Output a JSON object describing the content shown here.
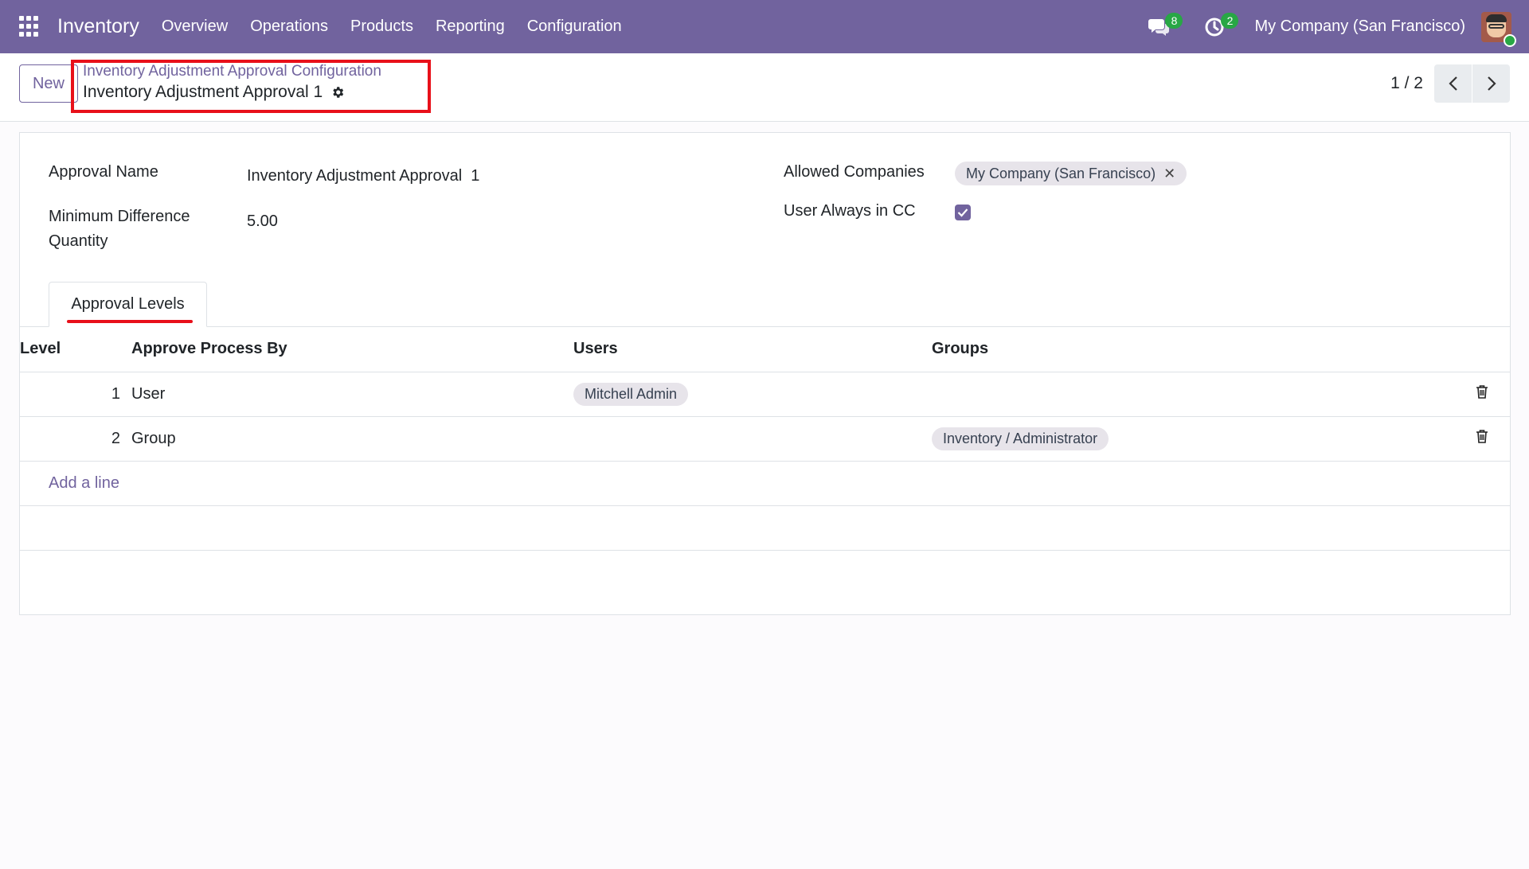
{
  "navbar": {
    "brand": "Inventory",
    "menu": [
      "Overview",
      "Operations",
      "Products",
      "Reporting",
      "Configuration"
    ],
    "messages_count": "8",
    "activities_count": "2",
    "company": "My Company (San Francisco)"
  },
  "control_panel": {
    "new_label": "New",
    "breadcrumb_parent": "Inventory Adjustment Approval Configuration",
    "breadcrumb_current": "Inventory Adjustment Approval 1",
    "pager_value": "1 / 2"
  },
  "form": {
    "approval_name_label": "Approval Name",
    "approval_name_value": "Inventory Adjustment Approval  1",
    "min_diff_label_line1": "Minimum Difference",
    "min_diff_label_line2": "Quantity",
    "min_diff_value": "5.00",
    "allowed_companies_label": "Allowed Companies",
    "allowed_company_tag": "My Company (San Francisco)",
    "user_cc_label": "User Always in CC",
    "user_cc_checked": true
  },
  "tabs": {
    "approval_levels": "Approval Levels"
  },
  "table": {
    "headers": {
      "level": "Level",
      "process": "Approve Process By",
      "users": "Users",
      "groups": "Groups"
    },
    "rows": [
      {
        "level": "1",
        "process": "User",
        "users": "Mitchell Admin",
        "groups": ""
      },
      {
        "level": "2",
        "process": "Group",
        "users": "",
        "groups": "Inventory / Administrator"
      }
    ],
    "add_line": "Add a line"
  },
  "colors": {
    "brand": "#71639e",
    "highlight": "#e8101a",
    "badge": "#28a745"
  }
}
